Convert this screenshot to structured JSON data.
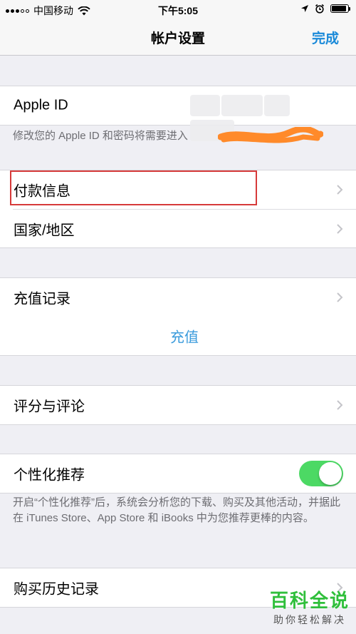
{
  "status_bar": {
    "carrier": "中国移动",
    "time": "下午5:05"
  },
  "nav": {
    "title": "帐户设置",
    "done": "完成"
  },
  "apple_id": {
    "label": "Apple ID",
    "footer": "修改您的 Apple ID 和密码将需要进入"
  },
  "payment_group": {
    "items": [
      "付款信息",
      "国家/地区"
    ]
  },
  "recharge_group": {
    "history": "充值记录",
    "recharge": "充值"
  },
  "review_group": {
    "item": "评分与评论"
  },
  "personal_group": {
    "item": "个性化推荐",
    "toggle_on": true,
    "footer": "开启“个性化推荐”后，系统会分析您的下载、购买及其他活动，并据此在 iTunes Store、App Store 和 iBooks 中为您推荐更棒的内容。"
  },
  "purchase_group": {
    "item": "购买历史记录"
  },
  "watermark": {
    "main": "百科全说",
    "sub": "助你轻松解决"
  },
  "colors": {
    "accent": "#1a8ad9",
    "link": "#3a9bdc",
    "toggle": "#4cd964",
    "highlight": "#d63a3a",
    "scribble": "#ff8a2a"
  }
}
